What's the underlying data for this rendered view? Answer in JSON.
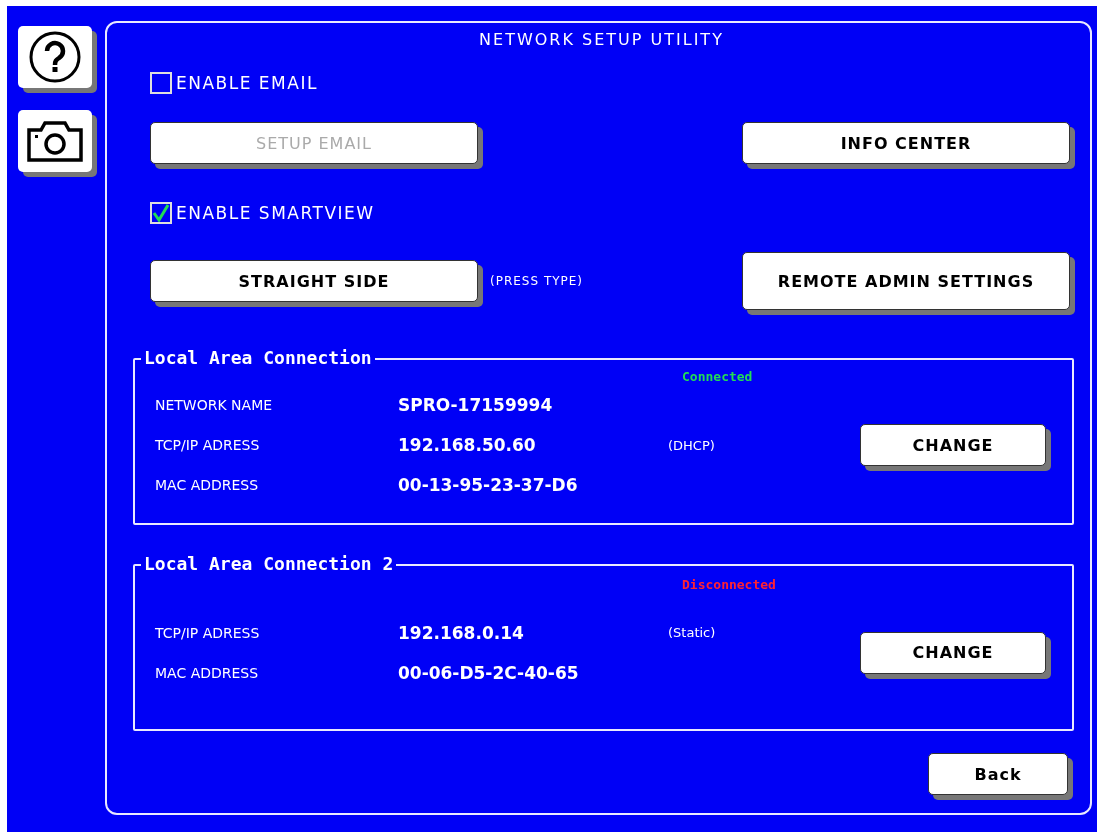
{
  "side_buttons": [
    {
      "kind": "help"
    },
    {
      "kind": "camera"
    }
  ],
  "title": "NETWORK SETUP UTILITY",
  "options": [
    {
      "label": "ENABLE EMAIL",
      "checked": false,
      "button": {
        "label": "SETUP EMAIL",
        "disabled": true
      },
      "right_button": {
        "label": "INFO CENTER",
        "disabled": false
      }
    },
    {
      "label": "ENABLE SMARTVIEW",
      "checked": true,
      "button": {
        "label": "STRAIGHT SIDE",
        "disabled": false
      },
      "note": "(PRESS TYPE)",
      "right_button": {
        "label": "REMOTE ADMIN SETTINGS",
        "disabled": false
      }
    }
  ],
  "connections": [
    {
      "name": "Local Area Connection",
      "status": "Connected",
      "color": "#22dd55",
      "rows": [
        {
          "label": "NETWORK NAME",
          "value": "SPRO-17159994"
        },
        {
          "label": "TCP/IP ADRESS",
          "value": "192.168.50.60",
          "note": "(DHCP)"
        },
        {
          "label": "MAC ADDRESS",
          "value": "00-13-95-23-37-D6"
        }
      ],
      "button": "CHANGE"
    },
    {
      "name": "Local Area Connection 2",
      "status": "Disconnected",
      "color": "#ff2233",
      "rows": [
        {
          "label": "TCP/IP ADRESS",
          "value": "192.168.0.14",
          "note": "(Static)"
        },
        {
          "label": "MAC ADDRESS",
          "value": "00-06-D5-2C-40-65"
        }
      ],
      "button": "CHANGE"
    }
  ],
  "back": "Back"
}
